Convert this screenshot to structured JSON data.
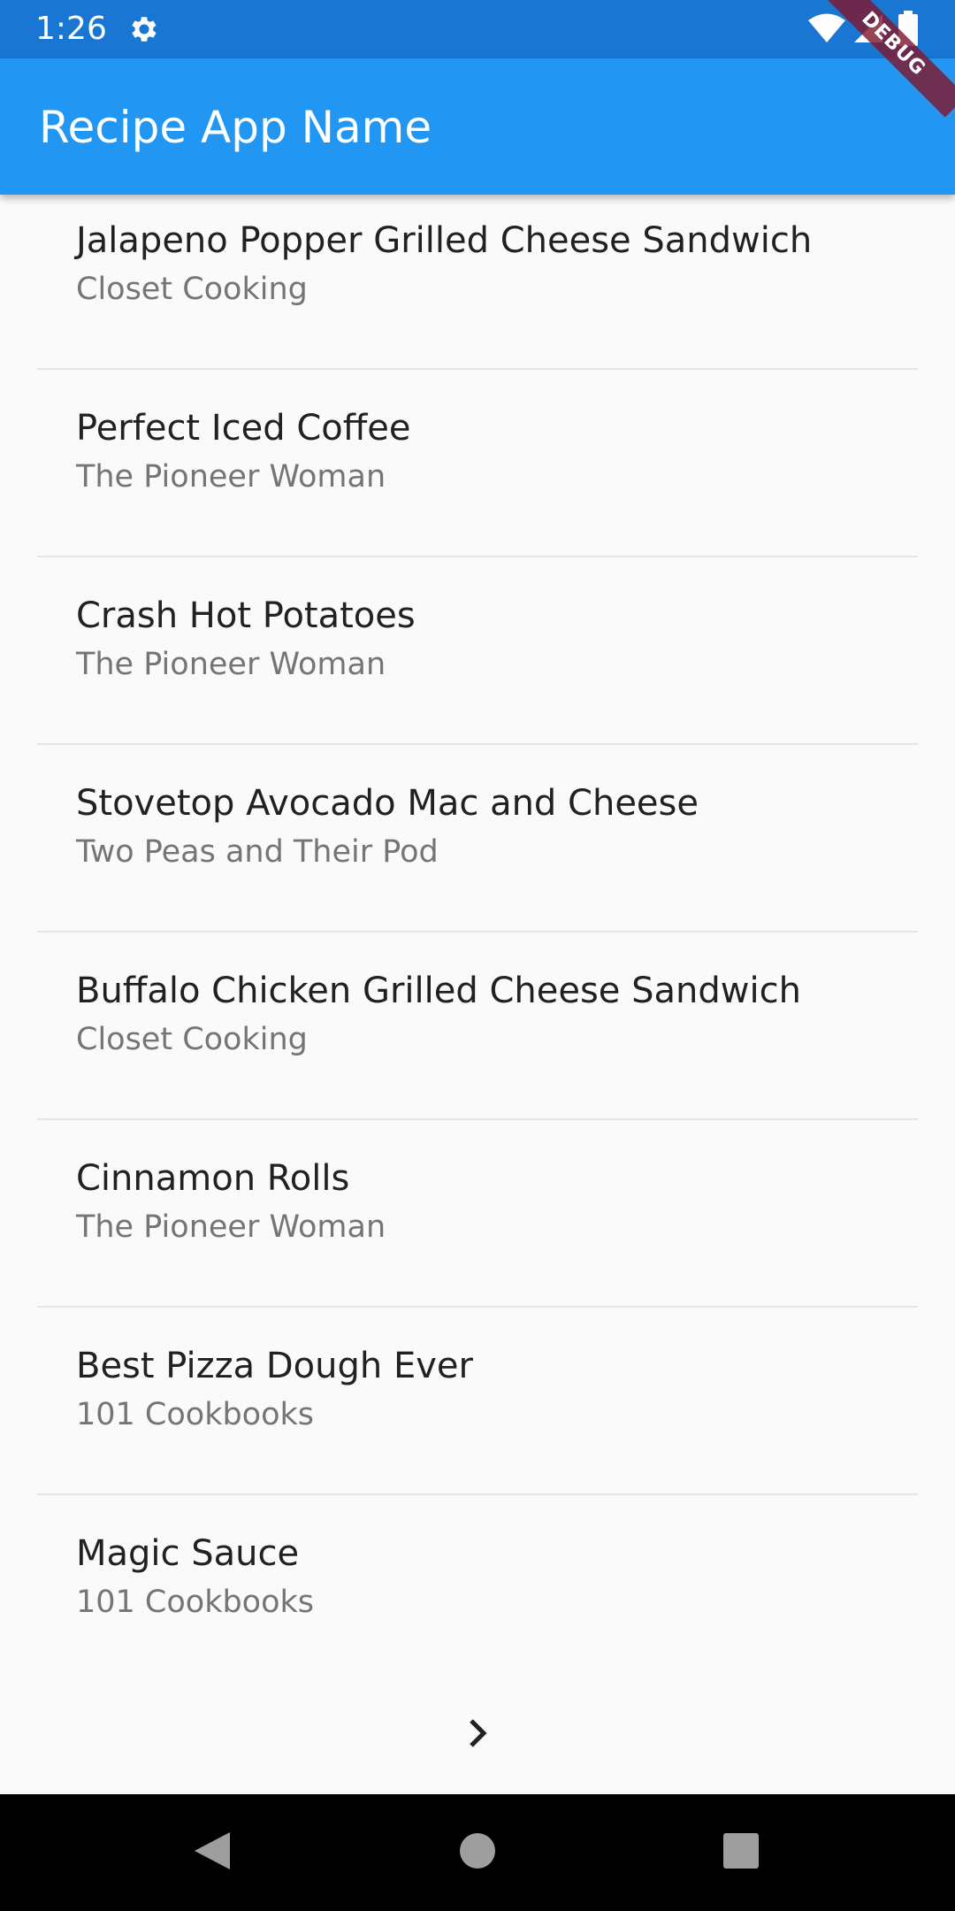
{
  "status_bar": {
    "time": "1:26",
    "icons": [
      "gear-icon",
      "wifi-icon",
      "cell-signal-icon",
      "battery-icon"
    ],
    "color": "#1976D2"
  },
  "app_bar": {
    "title": "Recipe App Name",
    "color": "#2196F3"
  },
  "debug_banner": {
    "label": "DEBUG"
  },
  "recipes": [
    {
      "title": "Jalapeno Popper Grilled Cheese Sandwich",
      "source": "Closet Cooking"
    },
    {
      "title": "Perfect Iced Coffee",
      "source": "The Pioneer Woman"
    },
    {
      "title": "Crash Hot Potatoes",
      "source": "The Pioneer Woman"
    },
    {
      "title": "Stovetop Avocado Mac and Cheese",
      "source": "Two Peas and Their Pod"
    },
    {
      "title": "Buffalo Chicken Grilled Cheese Sandwich",
      "source": "Closet Cooking"
    },
    {
      "title": "Cinnamon Rolls",
      "source": "The Pioneer Woman"
    },
    {
      "title": "Best Pizza Dough Ever",
      "source": "101 Cookbooks"
    },
    {
      "title": "Magic Sauce",
      "source": "101 Cookbooks"
    }
  ],
  "pagination": {
    "next_icon": "chevron-right-icon"
  },
  "nav_bar": {
    "buttons": [
      "back-icon",
      "home-icon",
      "recents-icon"
    ]
  }
}
